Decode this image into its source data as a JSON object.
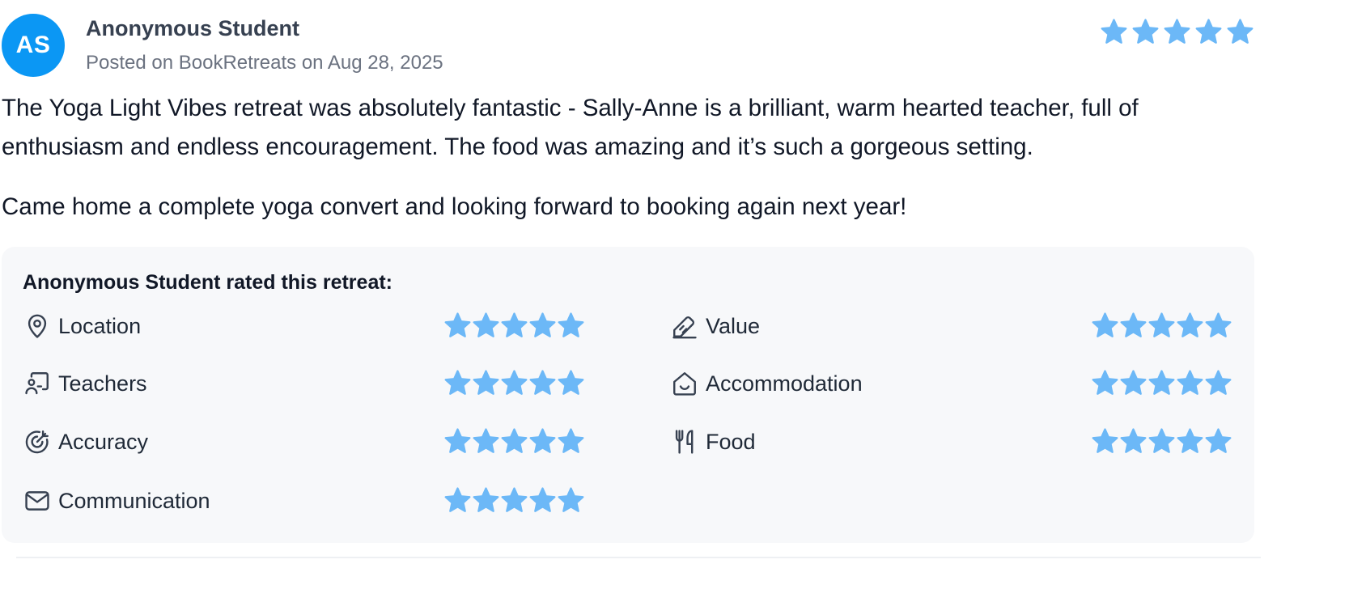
{
  "reviewer": {
    "initials": "AS",
    "name": "Anonymous Student",
    "posted": "Posted on BookRetreats on Aug 28, 2025",
    "overall_rating": 5
  },
  "review": {
    "paragraphs": [
      "The Yoga Light Vibes retreat was absolutely fantastic - Sally-Anne is a brilliant, warm hearted teacher, full of enthusiasm and endless encouragement. The food was amazing and it’s such a gorgeous setting.",
      "Came home a complete yoga convert and looking forward to booking again next year!"
    ]
  },
  "ratings": {
    "title": "Anonymous Student rated this retreat:",
    "max_stars": 5,
    "star_color": "#6cb8f7",
    "categories": [
      {
        "label": "Location",
        "icon": "map-pin-icon",
        "stars": 5
      },
      {
        "label": "Value",
        "icon": "price-tag-icon",
        "stars": 5
      },
      {
        "label": "Teachers",
        "icon": "teacher-icon",
        "stars": 5
      },
      {
        "label": "Accommodation",
        "icon": "home-smile-icon",
        "stars": 5
      },
      {
        "label": "Accuracy",
        "icon": "target-icon",
        "stars": 5
      },
      {
        "label": "Food",
        "icon": "utensils-icon",
        "stars": 5
      },
      {
        "label": "Communication",
        "icon": "envelope-icon",
        "stars": 5
      }
    ]
  },
  "colors": {
    "avatar_bg": "#0b97f4",
    "star": "#6cb8f7",
    "panel_bg": "#f7f8fa"
  }
}
